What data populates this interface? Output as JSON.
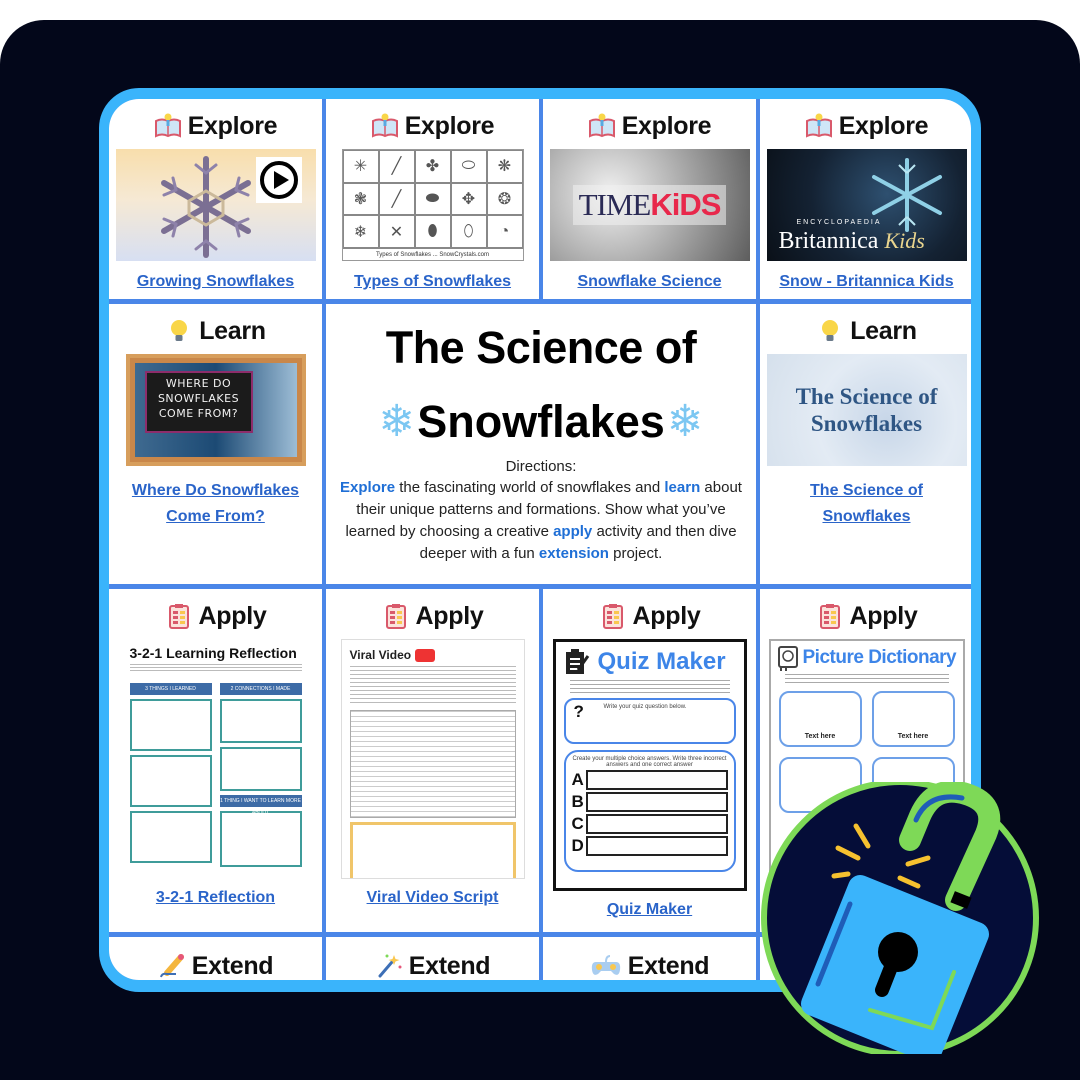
{
  "board": {
    "title_line1": "The Science of",
    "title_line2": "Snowflakes",
    "title_snowflake_icon": "❄",
    "directions_label": "Directions:",
    "directions": {
      "kw_explore": "Explore",
      "t1": " the fascinating world of snowflakes and ",
      "kw_learn": "learn",
      "t2": " about their unique patterns and formations. Show what you’ve learned by choosing a creative ",
      "kw_apply": "apply",
      "t3": " activity and then dive deeper with a fun ",
      "kw_extension": "extension",
      "t4": " project."
    }
  },
  "explore": [
    {
      "heading": "Explore",
      "icon": "book-bulb-icon",
      "link": "Growing Snowflakes",
      "thumb": "growing-snowflakes-video"
    },
    {
      "heading": "Explore",
      "icon": "book-bulb-icon",
      "link": "Types of Snowflakes",
      "thumb": "types-of-snowflakes-chart",
      "thumb_caption": "Types of Snowflakes ... SnowCrystals.com"
    },
    {
      "heading": "Explore",
      "icon": "book-bulb-icon",
      "link": "Snowflake Science",
      "thumb": "time-kids",
      "logo_a": "TIME",
      "logo_b": "KiDS"
    },
    {
      "heading": "Explore",
      "icon": "book-bulb-icon",
      "link": "Snow - Britannica Kids",
      "thumb": "britannica-kids",
      "logo_top": "ENCYCLOPAEDIA",
      "logo_a": "Britannica",
      "logo_b": "Kids"
    }
  ],
  "learn": [
    {
      "heading": "Learn",
      "icon": "lightbulb-icon",
      "link_line1": "Where Do Snowflakes",
      "link_line2": "Come From?",
      "thumb_text": [
        "WHERE DO",
        "SNOWFLAKES",
        "COME FROM?"
      ]
    },
    {
      "heading": "Learn",
      "icon": "lightbulb-icon",
      "link_line1": "The Science of",
      "link_line2": "Snowflakes",
      "thumb_text": [
        "The Science of",
        "Snowflakes"
      ]
    }
  ],
  "apply": [
    {
      "heading": "Apply",
      "icon": "checklist-icon",
      "link": "3-2-1 Reflection",
      "doc_title": "3-2-1 Learning Reflection",
      "doc_sections": [
        "3 THINGS I LEARNED",
        "2 CONNECTIONS I MADE",
        "1 THING I WANT TO LEARN MORE ABOUT"
      ]
    },
    {
      "heading": "Apply",
      "icon": "checklist-icon",
      "link": "Viral Video Script",
      "doc_title": "Viral Video"
    },
    {
      "heading": "Apply",
      "icon": "checklist-icon",
      "link": "Quiz Maker",
      "doc_title": "Quiz Maker",
      "question_prompt": "Write your quiz question below.",
      "answers_prompt": "Create your multiple choice answers. Write three incorrect answers and one correct answer",
      "options": [
        "A",
        "B",
        "C",
        "D"
      ]
    },
    {
      "heading": "Apply",
      "icon": "checklist-icon",
      "doc_title": "Picture Dictionary",
      "card_label": "Text here"
    }
  ],
  "extend": [
    {
      "heading": "Extend",
      "icon": "pencil-icon"
    },
    {
      "heading": "Extend",
      "icon": "magic-wand-icon"
    },
    {
      "heading": "Extend",
      "icon": "game-controller-icon"
    }
  ],
  "colors": {
    "backdrop": "#03071a",
    "frame": "#3ab4fb",
    "grid_lines": "#4a86e8",
    "link": "#2a64c9",
    "keyword": "#1f6fd6",
    "lock_body": "#3ab4fb",
    "lock_shackle": "#7ed957",
    "lock_rays": "#f6c12f"
  },
  "badge": {
    "icon": "unlocked-padlock-icon"
  }
}
